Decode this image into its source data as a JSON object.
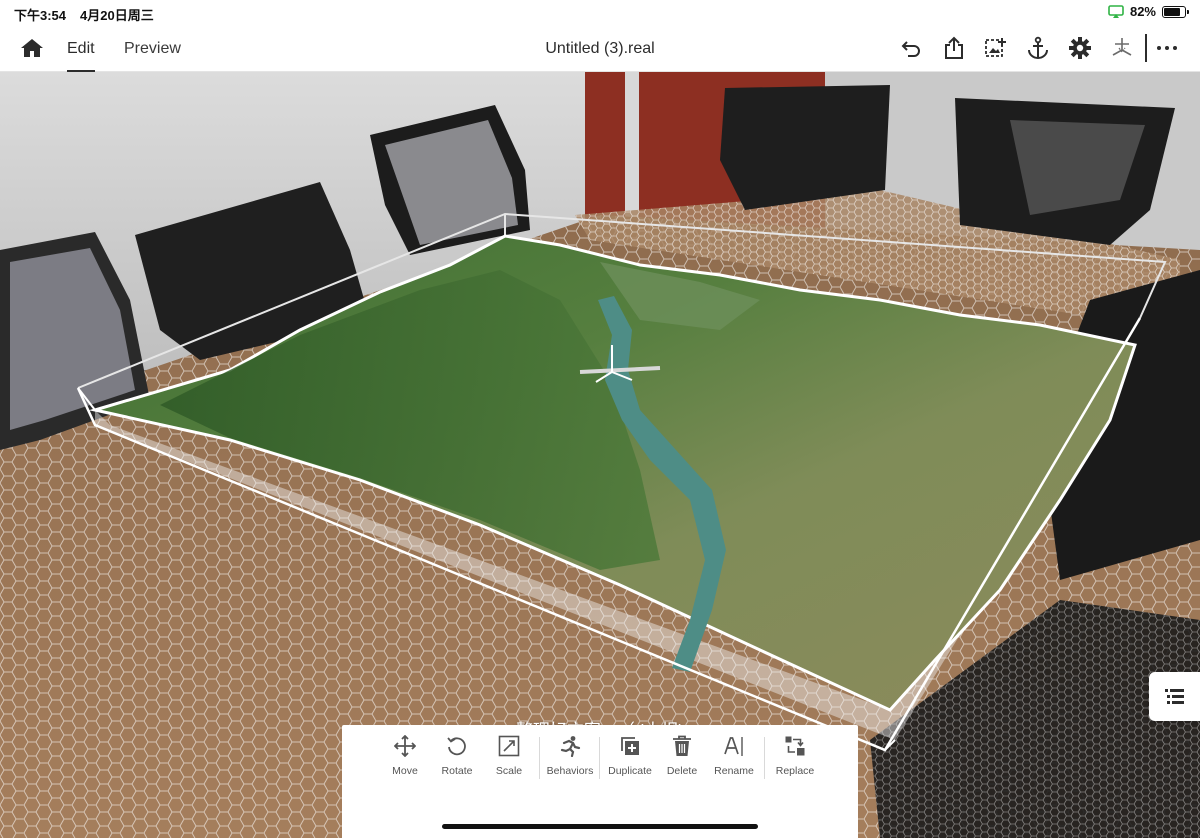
{
  "status_bar": {
    "time": "下午3:54",
    "date": "4月20日周三",
    "battery_percent": "82%",
    "battery_level": 0.82
  },
  "toolbar": {
    "tabs": [
      {
        "label": "Edit",
        "active": true
      },
      {
        "label": "Preview",
        "active": false
      }
    ],
    "document_title": "Untitled (3).real",
    "icons": [
      "home-icon",
      "undo-icon",
      "share-icon",
      "add-image-icon",
      "anchor-icon",
      "gear-icon",
      "ar-axes-icon",
      "more-icon"
    ]
  },
  "scene": {
    "object_label": "整理好方案一（d大坝)"
  },
  "actions": [
    {
      "label": "Move",
      "icon": "move-icon"
    },
    {
      "label": "Rotate",
      "icon": "rotate-icon"
    },
    {
      "label": "Scale",
      "icon": "scale-icon"
    },
    {
      "label": "Behaviors",
      "icon": "behaviors-icon"
    },
    {
      "label": "Duplicate",
      "icon": "duplicate-icon"
    },
    {
      "label": "Delete",
      "icon": "trash-icon"
    },
    {
      "label": "Rename",
      "icon": "rename-icon"
    },
    {
      "label": "Replace",
      "icon": "replace-icon"
    }
  ],
  "colors": {
    "toolbar_bg": "#ffffff",
    "icon_dark": "#2c2c2c",
    "floor_brown": "#9a7555",
    "terrain_green": "#4d7a3b",
    "river": "#4e8d86",
    "status_green": "#2fb344"
  }
}
